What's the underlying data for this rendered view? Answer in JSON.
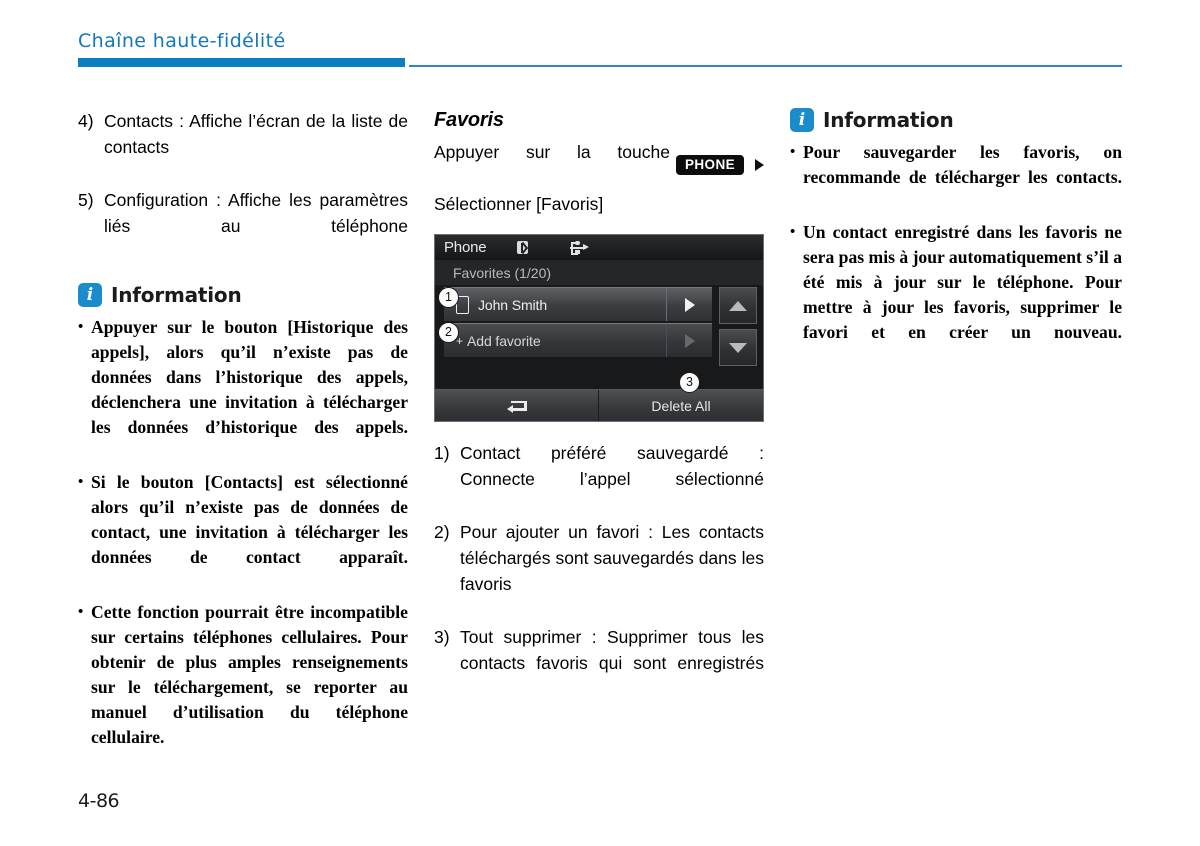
{
  "header": {
    "title": "Chaîne haute-fidélité",
    "accent_color": "#0b7ec0",
    "rule_color": "#2f86c4"
  },
  "footer": {
    "page_number": "4-86"
  },
  "left_column": {
    "numbered_items": [
      {
        "marker": "4)",
        "text": "Contacts : Affiche l’écran de la liste de contacts"
      },
      {
        "marker": "5)",
        "text": "Configuration : Affiche les paramètres liés au téléphone"
      }
    ],
    "information": {
      "icon": "info-icon",
      "title": "Information",
      "bullets": [
        "Appuyer sur le bouton [Historique des appels], alors qu’il n’existe pas de données dans l’historique des appels, déclenchera une invitation à télécharger les données d’historique des appels.",
        "Si le bouton [Contacts] est sélectionné alors qu’il n’existe pas de données de contact, une invitation à télécharger les données de contact apparaît.",
        "Cette fonction pourrait être incompatible sur certains téléphones cellulaires. Pour obtenir de plus amples renseignements sur le téléchargement, se reporter au manuel d’utilisation du téléphone cellulaire."
      ]
    }
  },
  "middle_column": {
    "heading": "Favoris",
    "instruction_prefix": "Appuyer sur la touche",
    "key_badge": "PHONE",
    "instruction_suffix": "Sélectionner [Favoris]",
    "device_screenshot": {
      "title": "Phone",
      "status_icons": [
        "bluetooth-icon",
        "usb-icon"
      ],
      "subtitle": "Favorites (1/20)",
      "rows": [
        {
          "label": "John Smith",
          "icon": "phone-device-icon",
          "action": "play-arrow-icon"
        },
        {
          "label": "Add favorite",
          "icon": "plus-icon",
          "action": "play-arrow-icon"
        }
      ],
      "scroll_buttons": [
        "scroll-up-icon",
        "scroll-down-icon"
      ],
      "bottom_buttons": [
        {
          "icon": "back-arrow-icon",
          "label": ""
        },
        {
          "icon": "",
          "label": "Delete All"
        }
      ],
      "callouts": [
        "1",
        "2",
        "3"
      ]
    },
    "numbered_items": [
      {
        "marker": "1)",
        "text": "Contact préféré sauvegardé : Connecte l’appel sélectionné"
      },
      {
        "marker": "2)",
        "text": "Pour ajouter un favori : Les contacts téléchargés sont sauvegardés dans les favoris"
      },
      {
        "marker": "3)",
        "text": "Tout supprimer : Supprimer tous les contacts favoris qui sont enregistrés"
      }
    ]
  },
  "right_column": {
    "information": {
      "icon": "info-icon",
      "title": "Information",
      "bullets": [
        "Pour sauvegarder les favoris, on recommande de télécharger les contacts.",
        "Un contact enregistré dans les favoris ne sera pas mis à jour automatiquement s’il a été mis à jour sur le téléphone. Pour mettre à jour les favoris, supprimer le favori et en créer un nouveau."
      ]
    }
  }
}
